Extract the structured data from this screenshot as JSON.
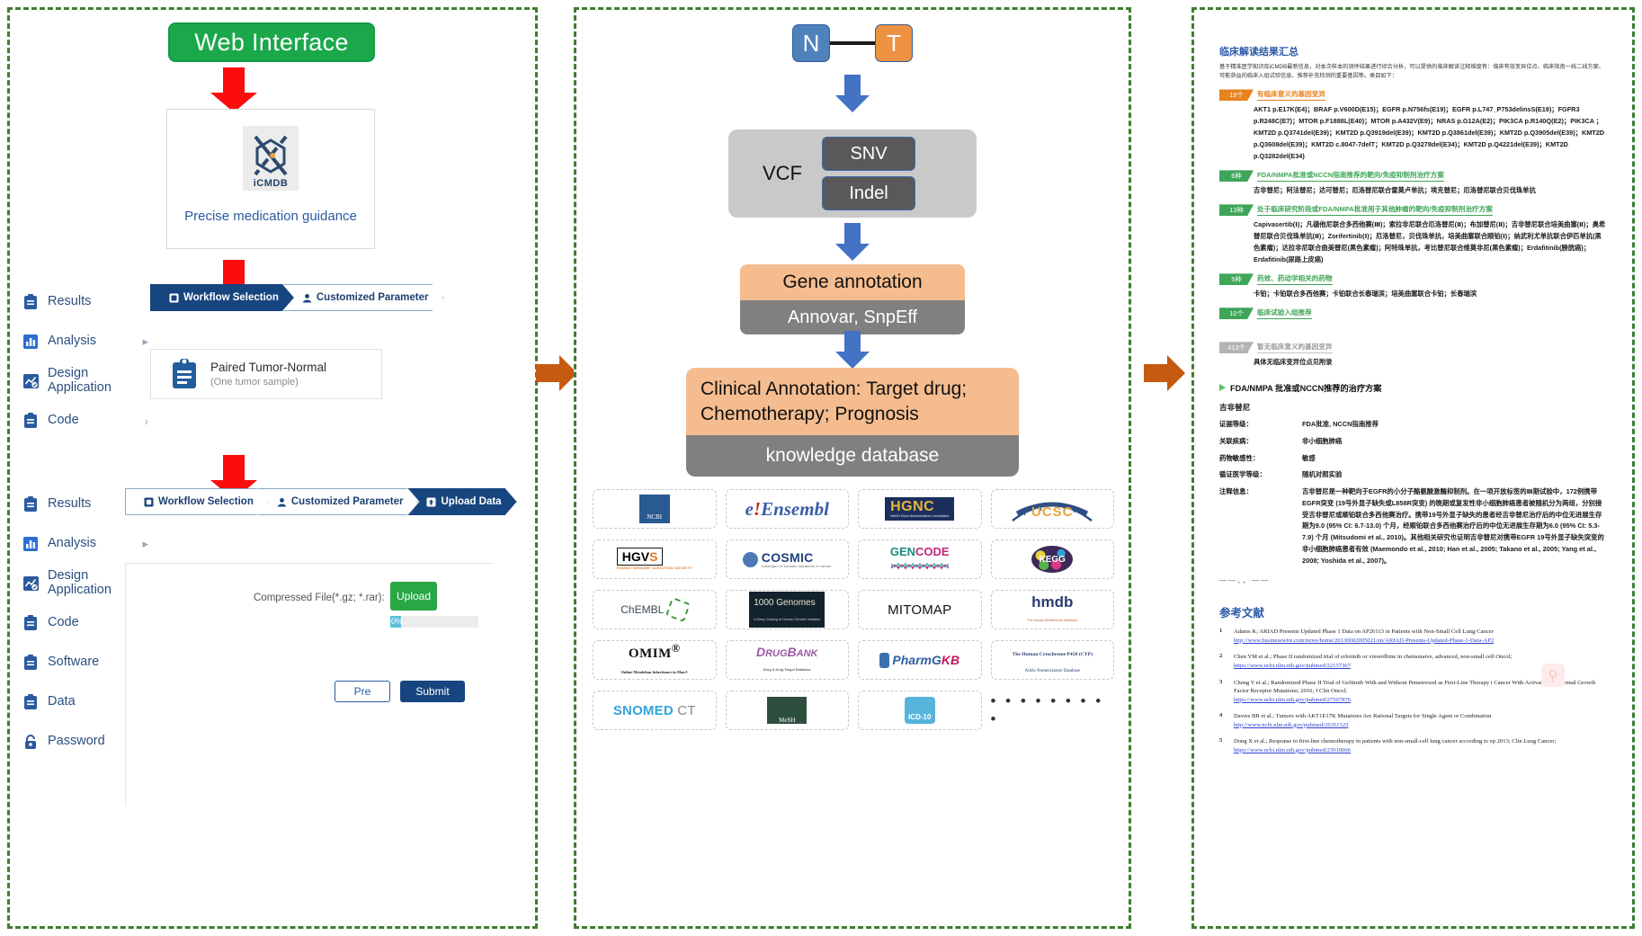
{
  "left_panel": {
    "header_button": "Web Interface",
    "card": {
      "logo_text": "iCMDB",
      "caption": "Precise medication guidance"
    },
    "sidebar_top": [
      {
        "icon": "clipboard-icon",
        "label": "Results",
        "chevron": ""
      },
      {
        "icon": "bar-chart-icon",
        "label": "Analysis",
        "chevron": "▸"
      },
      {
        "icon": "design-icon",
        "label": "Design Application",
        "chevron": ""
      },
      {
        "icon": "clipboard-icon",
        "label": "Code",
        "chevron": "›"
      }
    ],
    "sidebar_bottom": [
      {
        "icon": "clipboard-icon",
        "label": "Results",
        "chevron": ""
      },
      {
        "icon": "bar-chart-icon",
        "label": "Analysis",
        "chevron": "▸"
      },
      {
        "icon": "design-icon",
        "label": "Design Application",
        "chevron": ""
      },
      {
        "icon": "clipboard-icon",
        "label": "Code",
        "chevron": "›"
      },
      {
        "icon": "clipboard-icon",
        "label": "Software",
        "chevron": "›"
      },
      {
        "icon": "clipboard-icon",
        "label": "Data",
        "chevron": "›"
      },
      {
        "icon": "lock-icon",
        "label": "Password",
        "chevron": ""
      }
    ],
    "steps_top": [
      {
        "label": "Workflow Selection",
        "icon": "note-icon",
        "active": true
      },
      {
        "label": "Customized Parameter",
        "icon": "user-icon",
        "active": false
      }
    ],
    "steps_bottom": [
      {
        "label": "Workflow Selection",
        "icon": "note-icon",
        "active": false
      },
      {
        "label": "Customized Parameter",
        "icon": "user-icon",
        "active": false
      },
      {
        "label": "Upload Data",
        "icon": "upload-icon",
        "active": true
      }
    ],
    "paired_card": {
      "title": "Paired Tumor-Normal",
      "subtitle": "(One tumor sample)"
    },
    "upload": {
      "file_label": "Compressed File(*.gz; *.rar):",
      "upload_button": "Upload",
      "progress_text": "0%",
      "progress_percent": 12,
      "prev_button": "Pre",
      "submit_button": "Submit"
    }
  },
  "mid_panel": {
    "samples": {
      "normal": "N",
      "tumor": "T"
    },
    "vcf": {
      "label": "VCF",
      "tags": [
        "SNV",
        "Indel"
      ]
    },
    "gene_annotation": {
      "title": "Gene annotation",
      "tools": "Annovar, SnpEff"
    },
    "clinical_annotation": {
      "title": "Clinical Annotation: Target drug; Chemotherapy; Prognosis",
      "subtitle": "knowledge database"
    },
    "databases": [
      {
        "name": "NCBI",
        "kind": "ncbi"
      },
      {
        "name": "Ensembl",
        "kind": "ensembl"
      },
      {
        "name": "HGNC",
        "kind": "hgnc",
        "sub": "HUGO Gene Nomenclature Committee"
      },
      {
        "name": "UCSC",
        "kind": "ucsc"
      },
      {
        "name": "HGVS",
        "kind": "hgvs",
        "sub": "HUMAN GENOME VARIATION SOCIETY"
      },
      {
        "name": "COSMIC",
        "kind": "cosmic",
        "sub": "Catalogue of somatic mutations in cancer"
      },
      {
        "name": "GENCODE",
        "kind": "gencode"
      },
      {
        "name": "KEGG",
        "kind": "kegg"
      },
      {
        "name": "ChEMBL",
        "kind": "chembl"
      },
      {
        "name": "1000 Genomes",
        "kind": "g1000",
        "sub": "A Deep Catalog of Human Genetic Variation"
      },
      {
        "name": "MITOMAP",
        "kind": "mitomap"
      },
      {
        "name": "hmdb",
        "kind": "hmdb",
        "sub": "The Human Metabolome Database"
      },
      {
        "name": "OMIM",
        "kind": "omim",
        "sub": "Online Mendelian Inheritance in Man®"
      },
      {
        "name": "DrugBank",
        "kind": "drugbank",
        "sub": "Drug & Drug Target Database"
      },
      {
        "name": "PharmGKB",
        "kind": "pharmgkb"
      },
      {
        "name": "The Human Cytochrome P450 (CYP) Allele Nomenclature Database",
        "kind": "cyp"
      },
      {
        "name": "SNOMED CT",
        "kind": "snomed"
      },
      {
        "name": "MeSH",
        "kind": "mesh"
      },
      {
        "name": "ICD-10",
        "kind": "icd"
      },
      {
        "name": "more",
        "kind": "dots",
        "text": "• • • • • • • • •"
      }
    ]
  },
  "right_panel": {
    "title": "临床解读结果汇总",
    "intro": "基于精准医学知识库iCMDB最新信息，对本次样本的测序结果进行综合分析，可以提供的临床解读注释维度有：临床有效变异位点、临床指南一线二线方案、可能获益的临床入组试验信息、推荐补充检测的重要基因等。类目如下：",
    "sections": [
      {
        "badge": "19个",
        "badge_color": "orange",
        "title": "有临床意义的基因变异",
        "body": "AKT1 p.E17K(E4)；BRAF p.V600D(E15)；EGFR p.N756fs(E19)；EGFR p.L747_P753delinsS(E19)；FGFR3 p.R248C(E7)；MTOR p.F1888L(E40)；MTOR p.A432V(E9)；NRAS p.G12A(E2)；PIK3CA p.R140Q(E2)；PIK3CA ；KMT2D p.Q3741del(E39)；KMT2D p.Q3919del(E39)；KMT2D p.Q3861del(E39)；KMT2D p.Q3905del(E39)；KMT2D p.Q3608del(E39)；KMT2D c.8047-7delT；KMT2D p.Q3278del(E34)；KMT2D p.Q4221del(E39)；KMT2D p.Q3282del(E34)"
      },
      {
        "badge": "6种",
        "badge_color": "green",
        "title": "FDA/NMPA批准或NCCN指南推荐的靶向/免疫抑制剂治疗方案",
        "body": "吉非替尼；阿法替尼；达可替尼；厄洛替尼联合雷莫卢单抗；埃克替尼；厄洛替尼联合贝伐珠单抗"
      },
      {
        "badge": "13种",
        "badge_color": "green",
        "title": "处于临床研究阶段或FDA/NMPA批准用于其他肿瘤的靶向/免疫抑制剂治疗方案",
        "body": "Capivasertib(Ⅰ)；凡德他尼联合多西他赛(Ⅲ)；索拉非尼联合厄洛替尼(Ⅱ)；布加替尼(Ⅱ)；吉非替尼联合培美曲塞(Ⅱ)；奥希替尼联合贝伐珠单抗(Ⅱ)；Zorifertinib(Ⅰ)；厄洛替尼，贝伐珠单抗，培美曲塞联合顺铂(Ⅰ)；纳武利尤单抗联合伊匹单抗(黑色素瘤)；达拉非尼联合曲美替尼(黑色素瘤)；阿特珠单抗，考比替尼联合维莫非尼(黑色素瘤)；Erdafitinib(膀胱癌)；Erdafitinib(尿路上皮癌)"
      },
      {
        "badge": "5种",
        "badge_color": "green",
        "title": "药效、药动学相关的药物",
        "body": "卡铂；卡铂联合多西他赛；卡铂联合长春瑞滨；培美曲塞联合卡铂；长春瑞滨"
      },
      {
        "badge": "10个",
        "badge_color": "green",
        "title": "临床试验入组推荐",
        "body": ""
      },
      {
        "badge": "413个",
        "badge_color": "grey",
        "title": "暂无临床意义的基因变异",
        "body": "具体无临床变异位点见附录"
      }
    ],
    "detail": {
      "heading": "FDA/NMPA 批准或NCCN推荐的治疗方案",
      "drug": "吉非替尼",
      "fields": [
        {
          "key": "证据等级：",
          "value": "FDA批准, NCCN指南推荐"
        },
        {
          "key": "关联疾病：",
          "value": "非小细胞肺癌"
        },
        {
          "key": "药物敏感性：",
          "value": "敏感"
        },
        {
          "key": "循证医学等级：",
          "value": "随机对照实验"
        },
        {
          "key": "注释信息：",
          "value": "吉非替尼是一种靶向于EGFR的小分子酪氨酸激酶抑制剂。在一项开放标签的Ⅲ期试验中，172例携带EGFR突变 (19号外显子缺失或L858R突变) 的晚期或复发性非小细胞肺癌患者被随机分为两组，分别接受吉非替尼或顺铂联合多西他赛治疗。携带19号外显子缺失的患者经吉非替尼治疗后的中位无进展生存期为9.0 (95% CI: 6.7-13.0) 个月，经顺铂联合多西他赛治疗后的中位无进展生存期为6.0 (95% CI: 5.3-7.9) 个月 (Mitsudomi et al., 2010)。其他相关研究也证明吉非替尼对携带EGFR 19号外显子缺失突变的非小细胞肺癌患者有效 (Maemondo et al., 2010; Han et al., 2005; Takano et al., 2005; Yang et al., 2008; Yoshida et al., 2007)。"
        }
      ],
      "ellipsis": "——、、——"
    },
    "references_title": "参考文献",
    "references": [
      {
        "num": "1",
        "text": "Adams K; ARIAD Presents Updated Phase 1 Data on AP26113 in Patients with Non-Small Cell Lung Cancer",
        "link": "http://www.businesswire.com/news/home/20130602005021/en/ARIAD-Presents-Updated-Phase-1-Data-AP2"
      },
      {
        "num": "2",
        "text": "Chen YM et al.; Phase II randomized trial of erlotinib or vinorelbine in chemonaive, advanced, non-small cell Oncol;",
        "link": "https://www.ncbi.nlm.nih.gov/pubmed/22157367"
      },
      {
        "num": "3",
        "text": "Cheng Y et al.; Randomized Phase II Trial of Gefitinib With and Without Pemetrexed as First-Line Therapy i Cancer With Activating Epidermal Growth Factor Receptor Mutations; 2016; J Clin Oncol;",
        "link": "https://www.ncbi.nlm.nih.gov/pubmed/27507876"
      },
      {
        "num": "4",
        "text": "Davies BR et al.; Tumors with AKT1E17K Mutations Are Rational Targets for Single Agent or Combination",
        "link": "http://www.ncbi.nlm.nih.gov/pubmed/26351323"
      },
      {
        "num": "5",
        "text": "Dong X et al.; Response to first-line chemotherapy in patients with non-small-cell lung cancer according to ep 2013; Clin Lung Cancer;",
        "link": "https://www.ncbi.nlm.nih.gov/pubmed/23910066"
      }
    ]
  },
  "colors": {
    "panel_border": "#3f7d2e",
    "green_btn": "#1aa84a",
    "red_arrow": "#fb0d0d",
    "blue_arrow": "#4472c4",
    "orange_arrow": "#c55a11",
    "step_active": "#17457f",
    "badge_orange": "#e8821e",
    "badge_green": "#3fa559",
    "badge_grey": "#b3b3b3"
  }
}
